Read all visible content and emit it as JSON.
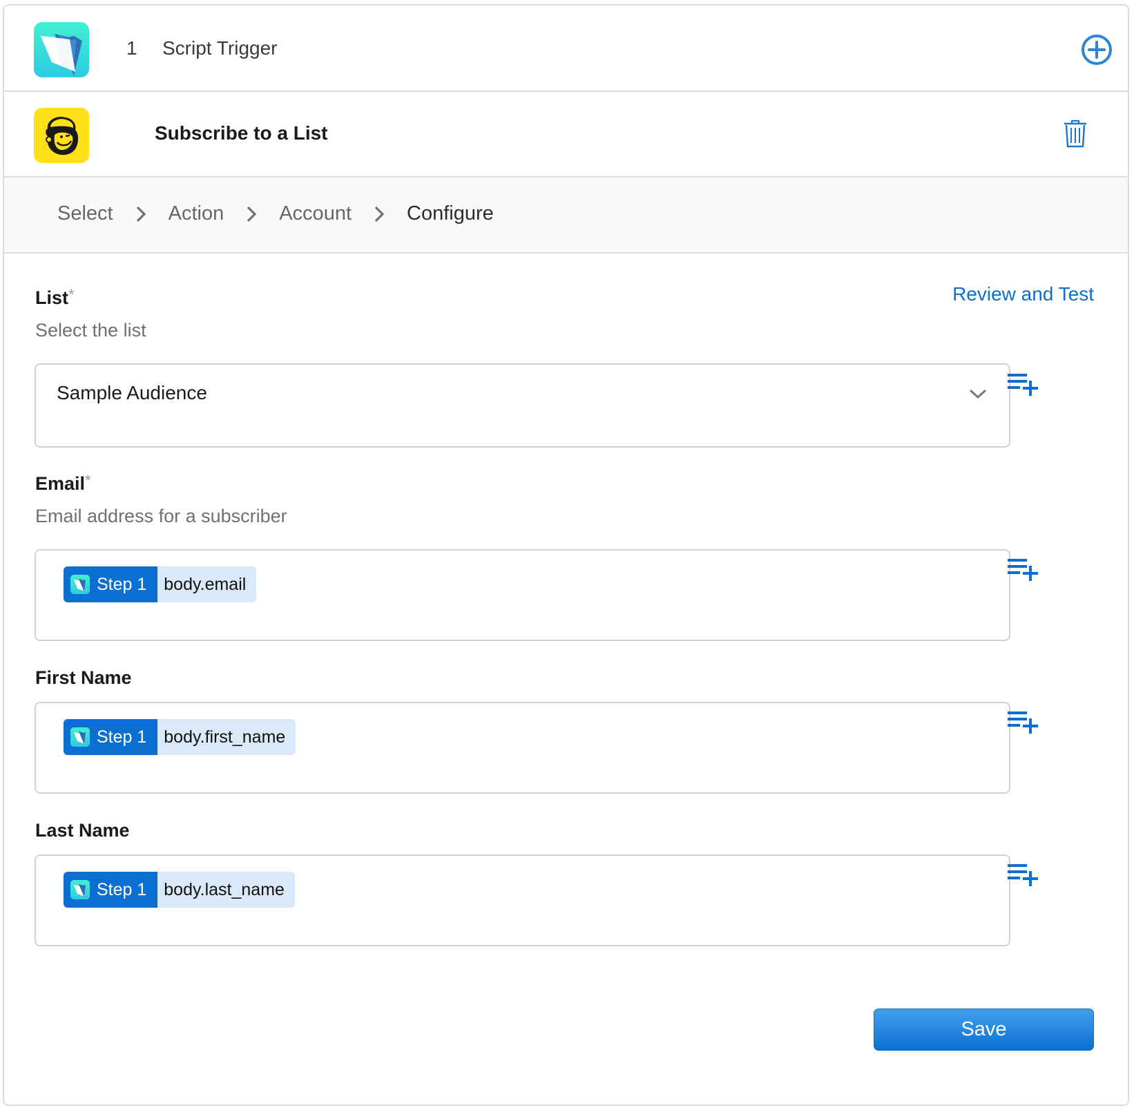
{
  "trigger_step": {
    "number": "1",
    "title": "Script Trigger",
    "icon": "filemaker-folder-icon",
    "add_icon": "plus-circle-icon"
  },
  "action_step": {
    "title": "Subscribe to a List",
    "icon": "mailchimp-freddie-icon",
    "delete_icon": "trash-icon"
  },
  "breadcrumbs": [
    {
      "label": "Select",
      "current": false
    },
    {
      "label": "Action",
      "current": false
    },
    {
      "label": "Account",
      "current": false
    },
    {
      "label": "Configure",
      "current": true
    }
  ],
  "review_link": "Review and Test",
  "fields": {
    "list": {
      "label": "List",
      "required_mark": "*",
      "description": "Select the list",
      "value": "Sample Audience"
    },
    "email": {
      "label": "Email",
      "required_mark": "*",
      "description": "Email address for a subscriber",
      "token": {
        "step": "Step 1",
        "field": "body.email"
      }
    },
    "first_name": {
      "label": "First Name",
      "token": {
        "step": "Step 1",
        "field": "body.first_name"
      }
    },
    "last_name": {
      "label": "Last Name",
      "token": {
        "step": "Step 1",
        "field": "body.last_name"
      }
    }
  },
  "save_label": "Save",
  "colors": {
    "accent": "#0a6fd0",
    "token_bg": "#d9e9f7",
    "mailchimp_yellow": "#ffe01b",
    "filemaker_teal": "#42efcf"
  }
}
